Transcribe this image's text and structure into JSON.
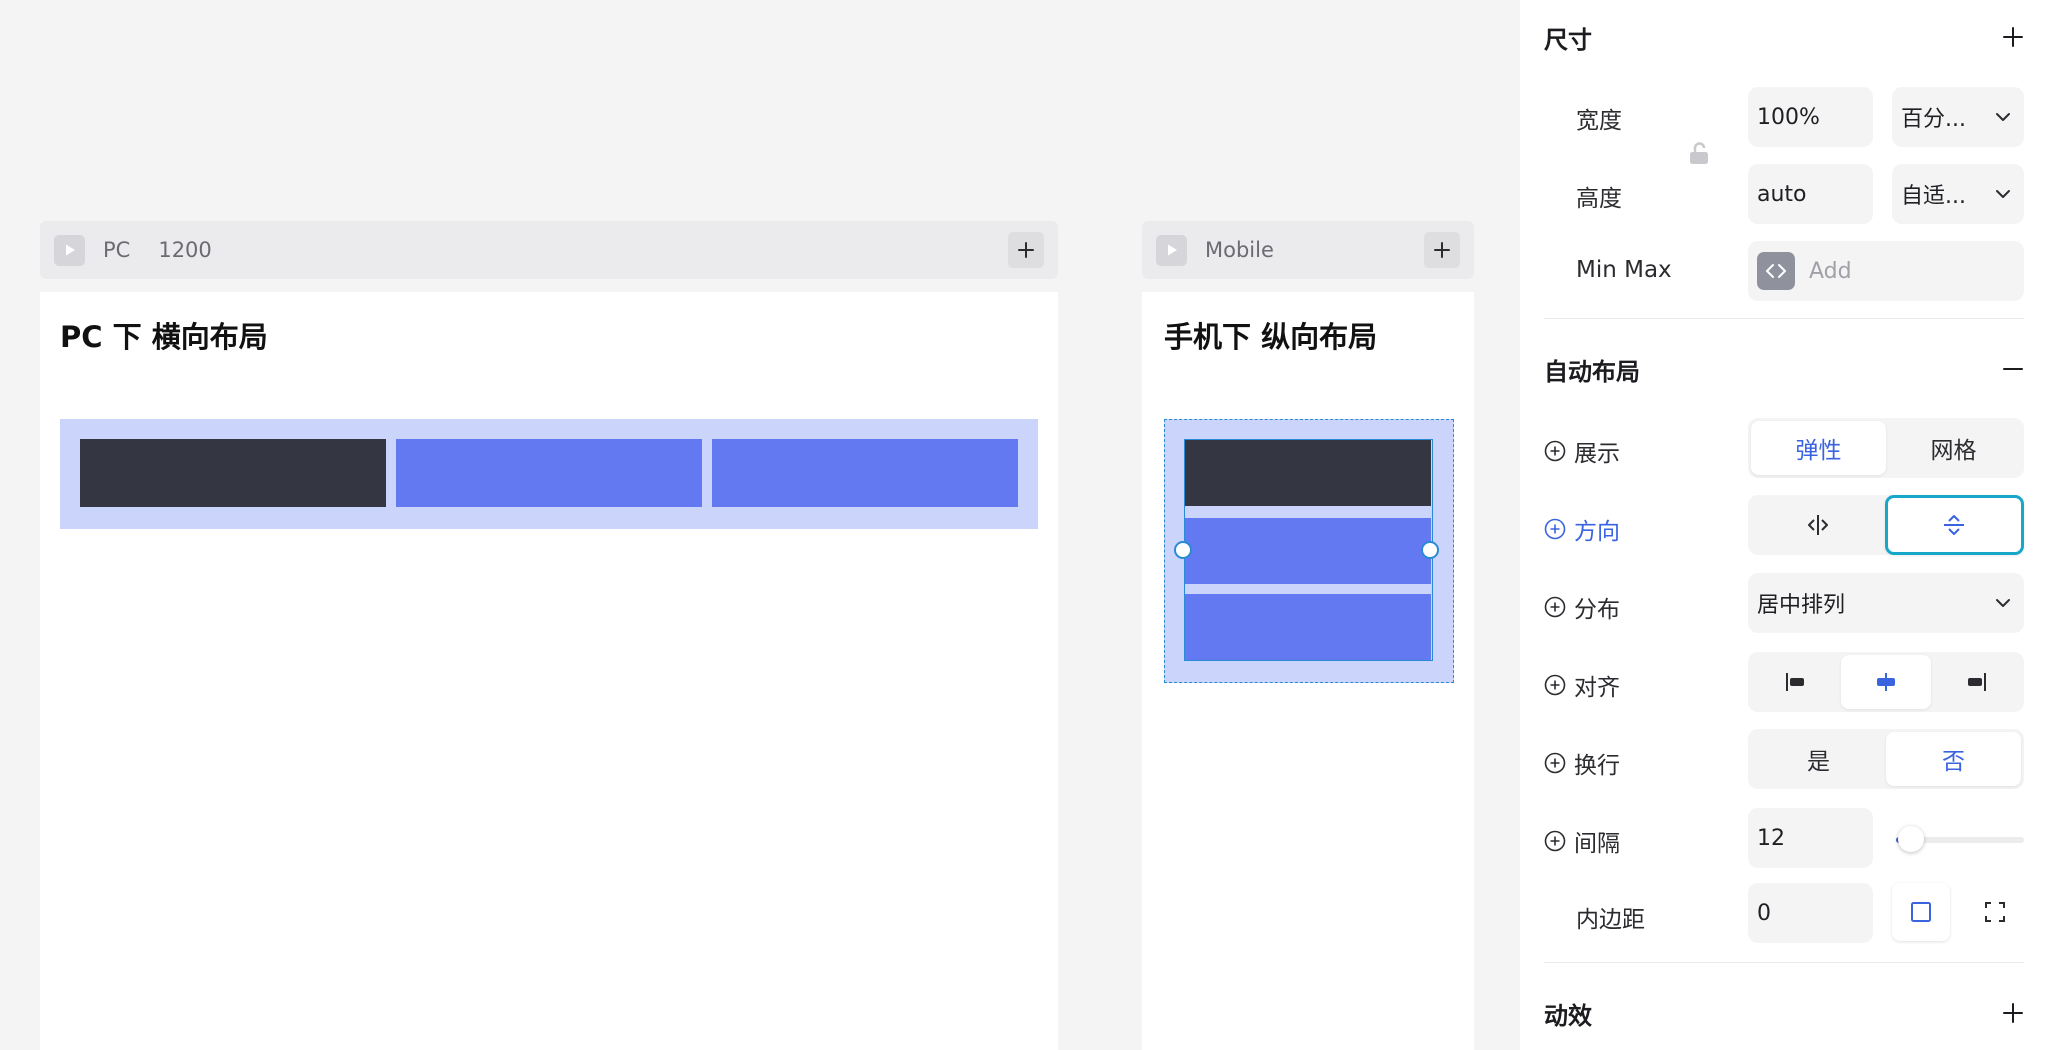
{
  "pc_frame": {
    "name": "PC",
    "size": "1200",
    "title": "PC 下 横向布局"
  },
  "mobile_frame": {
    "name": "Mobile",
    "title": "手机下 纵向布局"
  },
  "colors": {
    "dark_box": "#343741",
    "blue_box": "#6279f1",
    "container": "#cbd4fa",
    "accent": "#3a63e0",
    "selection": "#2a8ad6"
  },
  "panel": {
    "size_section": {
      "title": "尺寸",
      "width_label": "宽度",
      "width_value": "100%",
      "width_unit": "百分...",
      "height_label": "高度",
      "height_value": "auto",
      "height_unit": "自适...",
      "minmax_label": "Min Max",
      "minmax_placeholder": "Add"
    },
    "auto_layout": {
      "title": "自动布局",
      "display_label": "展示",
      "display_options": [
        "弹性",
        "网格"
      ],
      "direction_label": "方向",
      "distribution_label": "分布",
      "distribution_value": "居中排列",
      "align_label": "对齐",
      "wrap_label": "换行",
      "wrap_options": [
        "是",
        "否"
      ],
      "gap_label": "间隔",
      "gap_value": "12",
      "padding_label": "内边距",
      "padding_value": "0"
    },
    "animation_section": {
      "title": "动效"
    }
  }
}
